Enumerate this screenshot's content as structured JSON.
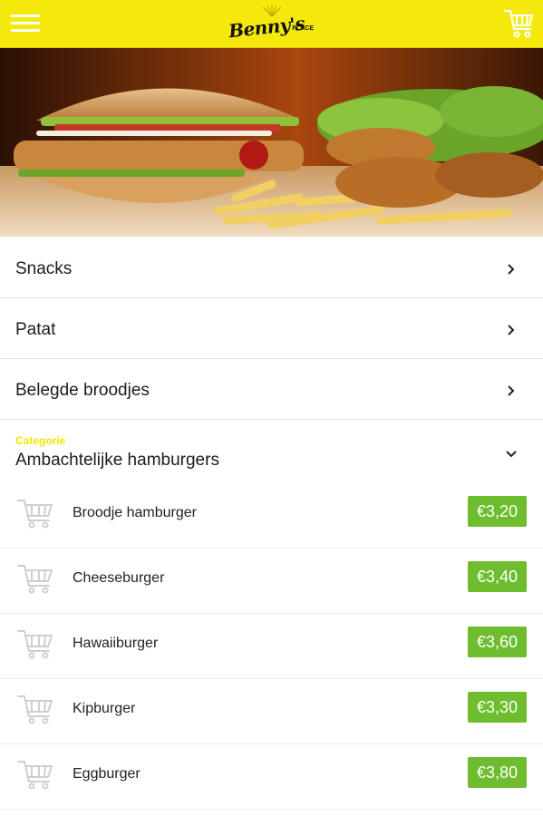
{
  "header": {
    "logo_text": "Benny's",
    "logo_sub": "PLACE",
    "icons": {
      "menu": "hamburger-menu-icon",
      "cart": "shopping-cart-icon"
    }
  },
  "categories": [
    {
      "label": "Snacks"
    },
    {
      "label": "Patat"
    },
    {
      "label": "Belegde broodjes"
    }
  ],
  "open_category": {
    "small_label": "Categorie",
    "label": "Ambachtelijke hamburgers",
    "items": [
      {
        "name": "Broodje hamburger",
        "price": "€3,20"
      },
      {
        "name": "Cheeseburger",
        "price": "€3,40"
      },
      {
        "name": "Hawaiiburger",
        "price": "€3,60"
      },
      {
        "name": "Kipburger",
        "price": "€3,30"
      },
      {
        "name": "Eggburger",
        "price": "€3,80"
      }
    ]
  },
  "colors": {
    "brand_yellow": "#f5e90c",
    "price_green": "#6dbd2e"
  }
}
